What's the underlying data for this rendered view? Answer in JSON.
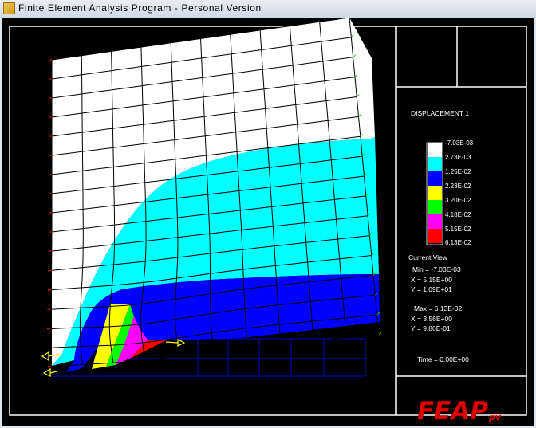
{
  "window": {
    "title": "Finite  Element  Analysis  Program  -  Personal  Version"
  },
  "legend": {
    "title": "DISPLACEMENT 1",
    "entries": [
      {
        "value": "-7.03E-03",
        "color": "#ffffff"
      },
      {
        "value": "2.73E-03",
        "color": "#00ffff"
      },
      {
        "value": "1.25E-02",
        "color": "#0000ff"
      },
      {
        "value": "2.23E-02",
        "color": "#ffff00"
      },
      {
        "value": "3.20E-02",
        "color": "#00ff00"
      },
      {
        "value": "4.18E-02",
        "color": "#ff00ff"
      },
      {
        "value": "5.15E-02",
        "color": "#ff0000"
      },
      {
        "value": "6.13E-02",
        "color": ""
      }
    ]
  },
  "current_view": {
    "label": "Current View",
    "min": "Min = -7.03E-03",
    "min_x": "X = 5.15E+00",
    "min_y": "Y = 1.09E+01",
    "max": "Max =  6.13E-02",
    "max_x": "X = 3.56E+00",
    "max_y": "Y = 9.86E-01"
  },
  "time": "Time = 0.00E+00",
  "logo": {
    "text": "FEAP",
    "suffix": "pv"
  },
  "colors": {
    "background": "#000000",
    "mesh": "#000000",
    "undeformed_mesh": "#0000cc",
    "frame": "#ffffff",
    "boundary_marks": "#ff0000",
    "load_arrows": "#ffff00"
  }
}
